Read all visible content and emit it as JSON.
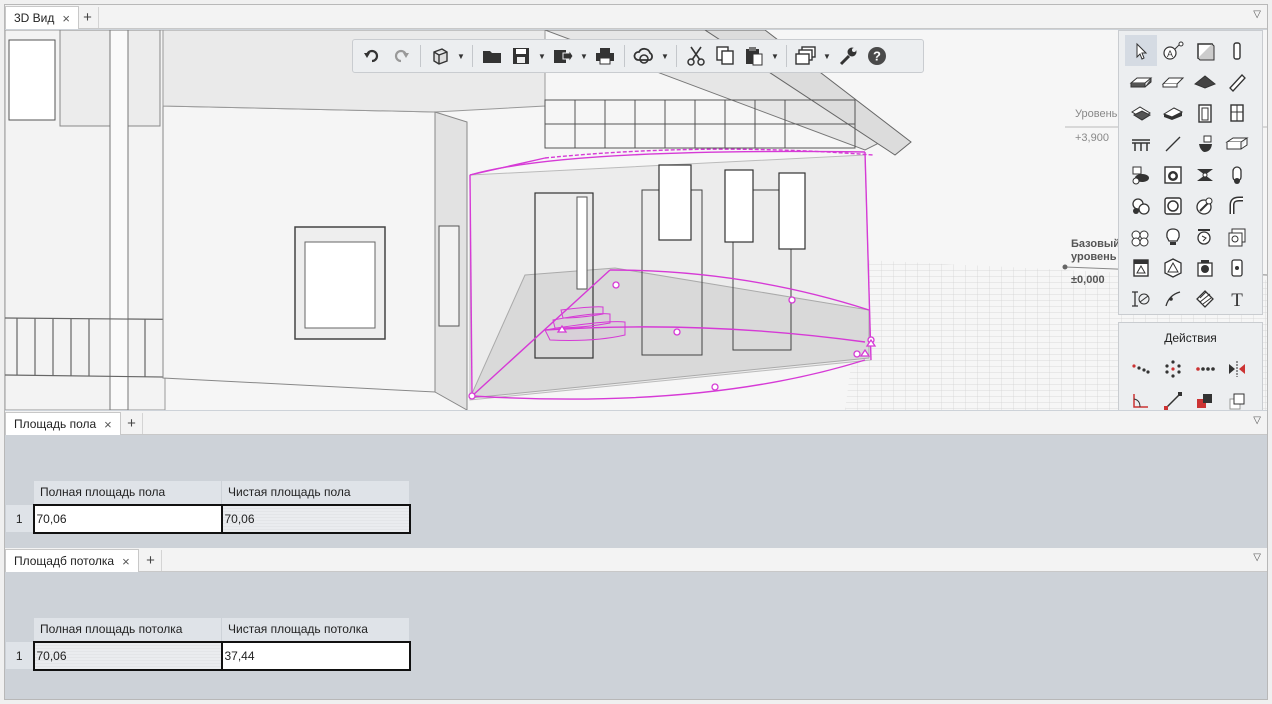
{
  "view_tab": {
    "label": "3D Вид",
    "close": "×",
    "add": "+"
  },
  "panel_menu_glyph": "▽",
  "levels": [
    {
      "name": "Уровень",
      "mark": "+3,900"
    },
    {
      "name": "Базовый",
      "name2": "уровень",
      "mark": "±0,000"
    }
  ],
  "toolbar": {
    "icons": [
      "undo-icon",
      "redo-icon",
      "view-cube-icon",
      "open-folder-icon",
      "save-icon",
      "export-icon",
      "print-icon",
      "cloud-sync-icon",
      "cut-icon",
      "copy-icon",
      "paste-icon",
      "layers-icon",
      "wrench-icon",
      "help-icon"
    ],
    "help_glyph": "?"
  },
  "palette": {
    "icons": [
      "select-pointer-icon",
      "annotation-icon",
      "wall-icon",
      "column-icon",
      "slab-icon",
      "ceiling-icon",
      "roof-icon",
      "beam-icon",
      "stair-icon",
      "ramp-icon",
      "door-icon",
      "window-icon",
      "railing-icon",
      "line-icon",
      "toilet-icon",
      "duct-icon",
      "sink-icon",
      "washer-icon",
      "fan-icon",
      "pipe-icon",
      "valve-icon",
      "tank-icon",
      "fitting-icon",
      "pipe-bend-icon",
      "equipment-icon",
      "lamp-icon",
      "sprinkler-icon",
      "box-icon",
      "panel-icon",
      "sphere-icon",
      "camera-icon",
      "socket-icon",
      "dimension-icon",
      "curve-icon",
      "hatch-icon",
      "text-icon"
    ],
    "text_glyph": "T",
    "annotation_glyph": "A"
  },
  "actions": {
    "title": "Действия",
    "icons": [
      "move-icon",
      "array-icon",
      "linear-array-icon",
      "mirror-icon",
      "angle-icon",
      "extend-icon",
      "offset-icon",
      "copy-offset-icon"
    ]
  },
  "floor_panel": {
    "tab_label": "Площадь пола",
    "columns": [
      "Полная площадь пола",
      "Чистая площадь пола"
    ],
    "rows": [
      {
        "num": "1",
        "values": [
          "70,06",
          "70,06"
        ]
      }
    ]
  },
  "ceiling_panel": {
    "tab_label": "Площадб потолка",
    "columns": [
      "Полная площадь потолка",
      "Чистая площадь потолка"
    ],
    "rows": [
      {
        "num": "1",
        "values": [
          "70,06",
          "37,44"
        ]
      }
    ]
  },
  "colors": {
    "selection": "#d63ad6",
    "grid": "#c8c8c8",
    "panel_bg": "#cdd2d8"
  }
}
